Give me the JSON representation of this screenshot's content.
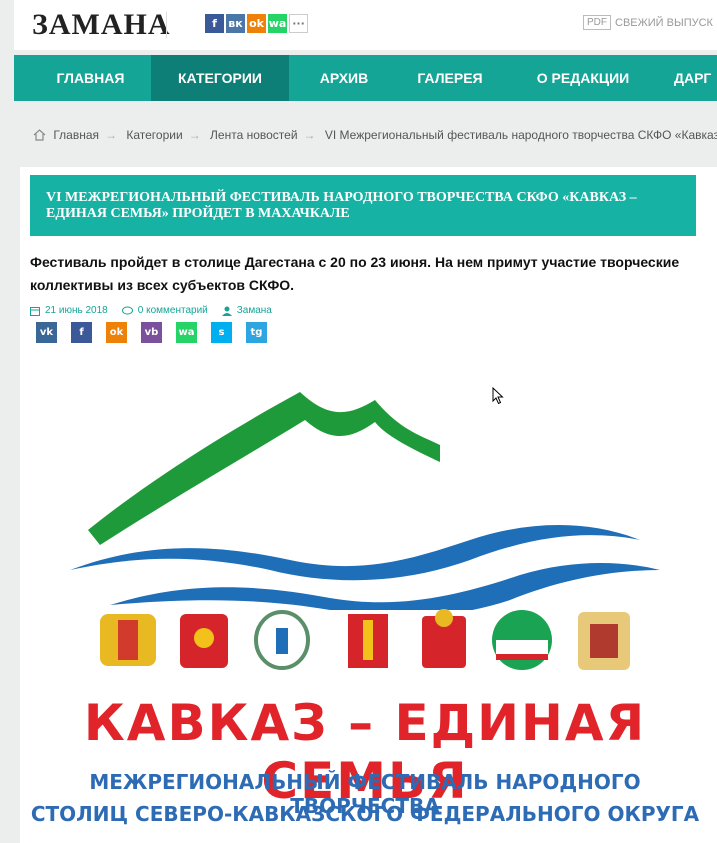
{
  "header": {
    "logo": "ЗАМАНА",
    "social": [
      "f",
      "вк",
      "ok",
      "wa",
      "···"
    ],
    "pdf": "PDF",
    "fresh_issue": "СВЕЖИЙ ВЫПУСК"
  },
  "nav": {
    "items": [
      "ГЛАВНАЯ",
      "КАТЕГОРИИ",
      "АРХИВ",
      "ГАЛЕРЕЯ",
      "О РЕДАКЦИИ",
      "ДАРГ"
    ],
    "active": "КАТЕГОРИИ"
  },
  "breadcrumb": [
    "Главная",
    "Категории",
    "Лента новостей",
    "VI Межрегиональный фестиваль народного творчества СКФО «Кавказ –"
  ],
  "article": {
    "title": "VI МЕЖРЕГИОНАЛЬНЫЙ ФЕСТИВАЛЬ НАРОДНОГО ТВОРЧЕСТВА СКФО «КАВКАЗ – ЕДИНАЯ СЕМЬЯ» ПРОЙДЕТ В МАХАЧКАЛЕ",
    "lead": "Фестиваль пройдет в столице Дагестана с 20 по 23 июня. На нем примут участие творческие коллективы из всех субъектов СКФО.",
    "date": "21 июнь 2018",
    "comments": "0 комментарий",
    "author": "Замана",
    "share": [
      "vk",
      "f",
      "ok",
      "vb",
      "wa",
      "s",
      "tg"
    ]
  },
  "poster": {
    "brand": "КАВКАЗ – ЕДИНАЯ СЕМЬЯ",
    "line1": "МЕЖРЕГИОНАЛЬНЫЙ ФЕСТИВАЛЬ НАРОДНОГО ТВОРЧЕСТВА",
    "line2": "СТОЛИЦ СЕВЕРО-КАВКАЗСКОГО ФЕДЕРАЛЬНОГО ОКРУГА"
  },
  "colors": {
    "teal": "#14a596",
    "teal_dark": "#0e7f76",
    "title_bg": "#16b3a5",
    "red": "#e0242a",
    "blue": "#2d6bb4",
    "green": "#1f9a3a"
  }
}
